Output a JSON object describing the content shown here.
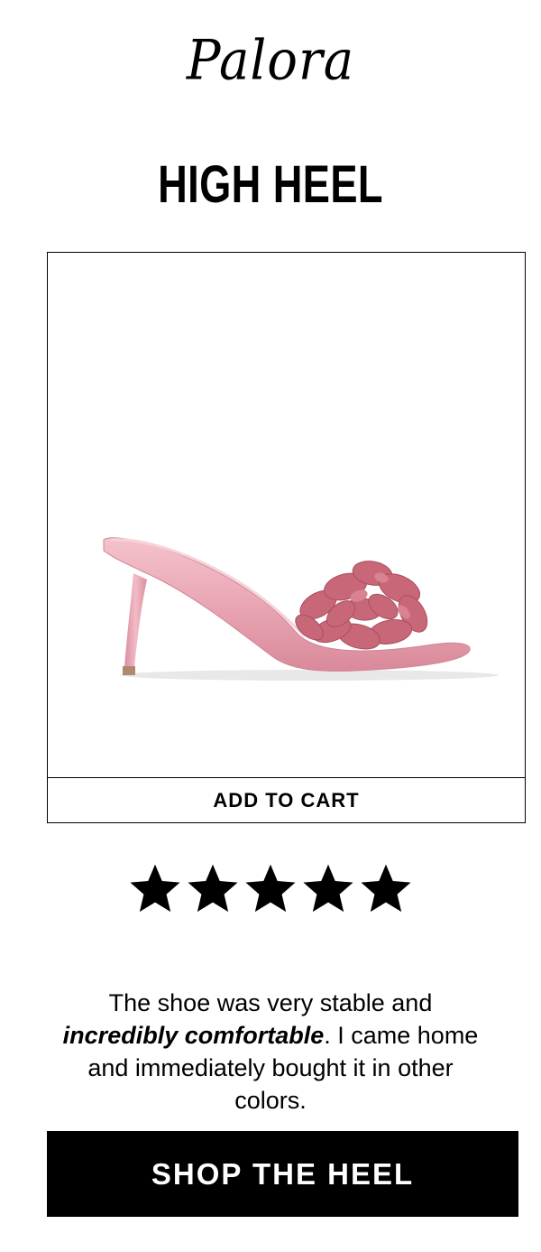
{
  "brand": {
    "logo_text": "Palora"
  },
  "hero": {
    "headline": "HIGH HEEL"
  },
  "product": {
    "image_alt": "pink satin flower mule high heel",
    "add_to_cart_label": "ADD TO CART"
  },
  "rating": {
    "stars": 5,
    "out_of": 5
  },
  "review": {
    "text_before": "The shoe was very stable and ",
    "emphasis": "incredibly comfortable",
    "text_after": ". I came home and immediately bought it in other colors."
  },
  "cta": {
    "label": "SHOP THE HEEL"
  },
  "colors": {
    "shoe_pink": "#e9a6b4",
    "petal_pink": "#c86777",
    "button_bg": "#000000"
  }
}
